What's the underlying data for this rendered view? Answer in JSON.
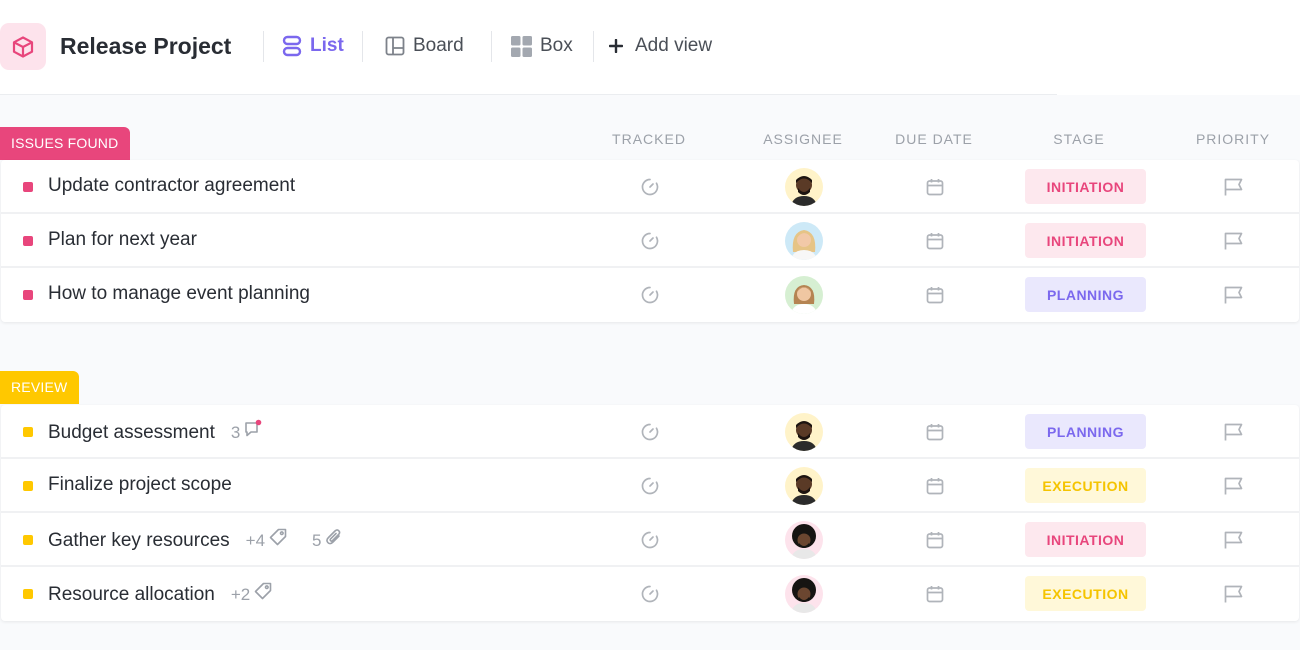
{
  "header": {
    "project_title": "Release Project",
    "views": [
      {
        "label": "List",
        "icon": "list-icon",
        "active": true
      },
      {
        "label": "Board",
        "icon": "board-icon",
        "active": false
      },
      {
        "label": "Box",
        "icon": "box-icon",
        "active": false
      }
    ],
    "add_view_label": "Add view",
    "app_icon": "cube-icon"
  },
  "columns": {
    "tracked": "TRACKED",
    "assignee": "ASSIGNEE",
    "due_date": "DUE DATE",
    "stage": "STAGE",
    "priority": "PRIORITY"
  },
  "colors": {
    "accent": "#7b68ee",
    "issues_found": "#e8467c",
    "review": "#ffc800",
    "initiation_bg": "#fde8ee",
    "initiation_fg": "#e8467c",
    "planning_bg": "#eae8fd",
    "planning_fg": "#7b68ee",
    "execution_bg": "#fff8d9",
    "execution_fg": "#f5c400"
  },
  "groups": [
    {
      "label": "ISSUES FOUND",
      "color": "#e8467c",
      "tasks": [
        {
          "name": "Update contractor agreement",
          "stage": "INITIATION",
          "stage_type": "initiation",
          "avatar": "avatar-man-1"
        },
        {
          "name": "Plan for next year",
          "stage": "INITIATION",
          "stage_type": "initiation",
          "avatar": "avatar-woman-1"
        },
        {
          "name": "How to manage event planning",
          "stage": "PLANNING",
          "stage_type": "planning",
          "avatar": "avatar-woman-2"
        }
      ]
    },
    {
      "label": "REVIEW",
      "color": "#ffc800",
      "tasks": [
        {
          "name": "Budget assessment",
          "comments": "3",
          "stage": "PLANNING",
          "stage_type": "planning",
          "avatar": "avatar-man-1"
        },
        {
          "name": "Finalize project scope",
          "stage": "EXECUTION",
          "stage_type": "execution",
          "avatar": "avatar-man-1"
        },
        {
          "name": "Gather key resources",
          "tags": "+4",
          "attachments": "5",
          "stage": "INITIATION",
          "stage_type": "initiation",
          "avatar": "avatar-man-2"
        },
        {
          "name": "Resource allocation",
          "tags": "+2",
          "stage": "EXECUTION",
          "stage_type": "execution",
          "avatar": "avatar-man-2"
        }
      ]
    }
  ]
}
